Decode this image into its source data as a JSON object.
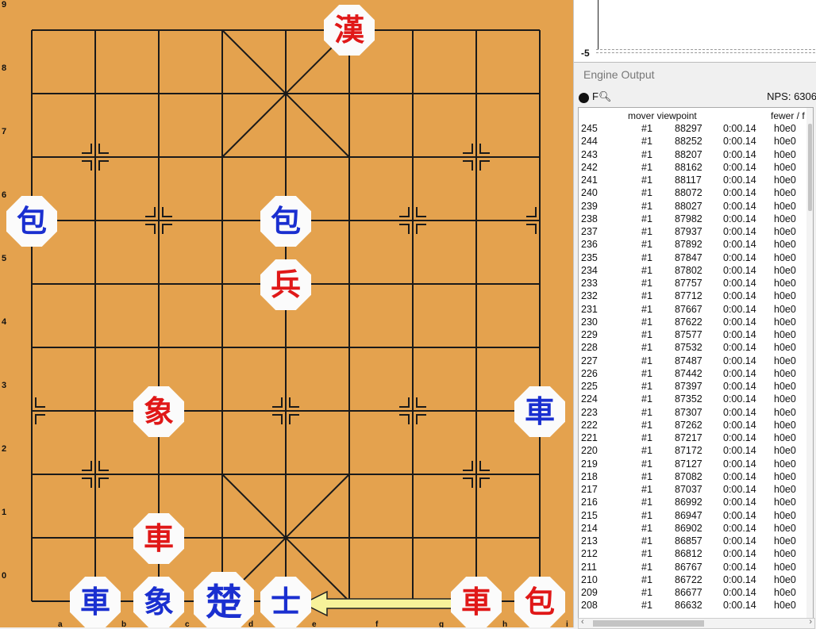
{
  "board": {
    "rank_labels": [
      "9",
      "8",
      "7",
      "6",
      "5",
      "4",
      "3",
      "2",
      "1",
      "0"
    ],
    "file_labels": [
      "a",
      "b",
      "c",
      "d",
      "e",
      "f",
      "g",
      "h",
      "i"
    ],
    "pieces": [
      {
        "char": "漢",
        "color": "red",
        "name": "red-general-piece"
      },
      {
        "char": "包",
        "color": "blue",
        "name": "blue-cannon-piece"
      },
      {
        "char": "包",
        "color": "blue",
        "name": "blue-cannon-piece"
      },
      {
        "char": "兵",
        "color": "red",
        "name": "red-soldier-piece"
      },
      {
        "char": "象",
        "color": "red",
        "name": "red-elephant-piece"
      },
      {
        "char": "車",
        "color": "blue",
        "name": "blue-chariot-piece"
      },
      {
        "char": "車",
        "color": "red",
        "name": "red-chariot-piece"
      },
      {
        "char": "車",
        "color": "blue",
        "name": "blue-chariot-piece"
      },
      {
        "char": "象",
        "color": "blue",
        "name": "blue-elephant-piece"
      },
      {
        "char": "楚",
        "color": "blue",
        "name": "blue-general-piece"
      },
      {
        "char": "士",
        "color": "blue",
        "name": "blue-advisor-piece"
      },
      {
        "char": "車",
        "color": "red",
        "name": "red-chariot-piece"
      },
      {
        "char": "包",
        "color": "red",
        "name": "red-cannon-piece"
      }
    ],
    "last_move": {
      "from": "g0",
      "to": "e0"
    }
  },
  "graph": {
    "label": "-5"
  },
  "engine": {
    "title": "Engine Output",
    "mode": "F",
    "nps": "NPS: 6306",
    "col_header": "mover viewpoint",
    "col_header_right": "fewer / f",
    "rows": [
      [
        "245",
        "#1",
        "88297",
        "0:00.14",
        "h0e0"
      ],
      [
        "244",
        "#1",
        "88252",
        "0:00.14",
        "h0e0"
      ],
      [
        "243",
        "#1",
        "88207",
        "0:00.14",
        "h0e0"
      ],
      [
        "242",
        "#1",
        "88162",
        "0:00.14",
        "h0e0"
      ],
      [
        "241",
        "#1",
        "88117",
        "0:00.14",
        "h0e0"
      ],
      [
        "240",
        "#1",
        "88072",
        "0:00.14",
        "h0e0"
      ],
      [
        "239",
        "#1",
        "88027",
        "0:00.14",
        "h0e0"
      ],
      [
        "238",
        "#1",
        "87982",
        "0:00.14",
        "h0e0"
      ],
      [
        "237",
        "#1",
        "87937",
        "0:00.14",
        "h0e0"
      ],
      [
        "236",
        "#1",
        "87892",
        "0:00.14",
        "h0e0"
      ],
      [
        "235",
        "#1",
        "87847",
        "0:00.14",
        "h0e0"
      ],
      [
        "234",
        "#1",
        "87802",
        "0:00.14",
        "h0e0"
      ],
      [
        "233",
        "#1",
        "87757",
        "0:00.14",
        "h0e0"
      ],
      [
        "232",
        "#1",
        "87712",
        "0:00.14",
        "h0e0"
      ],
      [
        "231",
        "#1",
        "87667",
        "0:00.14",
        "h0e0"
      ],
      [
        "230",
        "#1",
        "87622",
        "0:00.14",
        "h0e0"
      ],
      [
        "229",
        "#1",
        "87577",
        "0:00.14",
        "h0e0"
      ],
      [
        "228",
        "#1",
        "87532",
        "0:00.14",
        "h0e0"
      ],
      [
        "227",
        "#1",
        "87487",
        "0:00.14",
        "h0e0"
      ],
      [
        "226",
        "#1",
        "87442",
        "0:00.14",
        "h0e0"
      ],
      [
        "225",
        "#1",
        "87397",
        "0:00.14",
        "h0e0"
      ],
      [
        "224",
        "#1",
        "87352",
        "0:00.14",
        "h0e0"
      ],
      [
        "223",
        "#1",
        "87307",
        "0:00.14",
        "h0e0"
      ],
      [
        "222",
        "#1",
        "87262",
        "0:00.14",
        "h0e0"
      ],
      [
        "221",
        "#1",
        "87217",
        "0:00.14",
        "h0e0"
      ],
      [
        "220",
        "#1",
        "87172",
        "0:00.14",
        "h0e0"
      ],
      [
        "219",
        "#1",
        "87127",
        "0:00.14",
        "h0e0"
      ],
      [
        "218",
        "#1",
        "87082",
        "0:00.14",
        "h0e0"
      ],
      [
        "217",
        "#1",
        "87037",
        "0:00.14",
        "h0e0"
      ],
      [
        "216",
        "#1",
        "86992",
        "0:00.14",
        "h0e0"
      ],
      [
        "215",
        "#1",
        "86947",
        "0:00.14",
        "h0e0"
      ],
      [
        "214",
        "#1",
        "86902",
        "0:00.14",
        "h0e0"
      ],
      [
        "213",
        "#1",
        "86857",
        "0:00.14",
        "h0e0"
      ],
      [
        "212",
        "#1",
        "86812",
        "0:00.14",
        "h0e0"
      ],
      [
        "211",
        "#1",
        "86767",
        "0:00.14",
        "h0e0"
      ],
      [
        "210",
        "#1",
        "86722",
        "0:00.14",
        "h0e0"
      ],
      [
        "209",
        "#1",
        "86677",
        "0:00.14",
        "h0e0"
      ],
      [
        "208",
        "#1",
        "86632",
        "0:00.14",
        "h0e0"
      ]
    ]
  }
}
